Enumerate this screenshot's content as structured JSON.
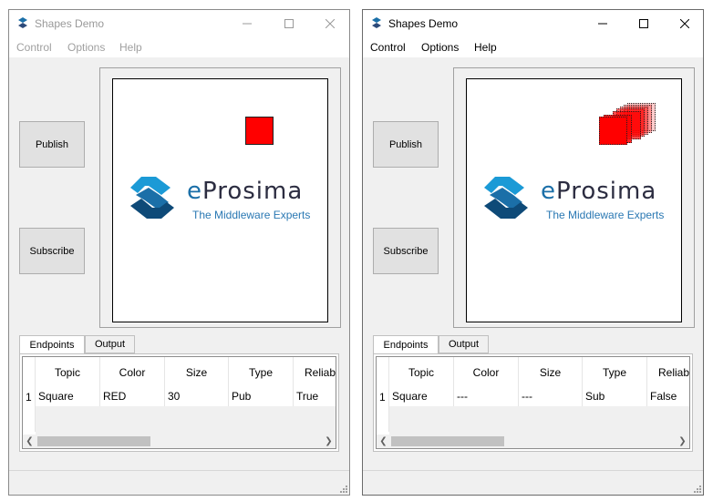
{
  "colors": {
    "accent": "#1b6fa8",
    "square_red": "#ff0000"
  },
  "windows": [
    {
      "title": "Shapes Demo",
      "menu": [
        "Control",
        "Options",
        "Help"
      ],
      "buttons": {
        "publish": "Publish",
        "subscribe": "Subscribe"
      },
      "logo": {
        "brand_e": "e",
        "brand_rest": "Prosima",
        "tagline": "The Middleware Experts"
      },
      "tabs": [
        "Endpoints",
        "Output"
      ],
      "table": {
        "columns": [
          "Topic",
          "Color",
          "Size",
          "Type",
          "Reliabl"
        ],
        "rows": [
          {
            "index": "1",
            "topic": "Square",
            "color": "RED",
            "size": "30",
            "type": "Pub",
            "reliable": "True"
          }
        ]
      }
    },
    {
      "title": "Shapes Demo",
      "menu": [
        "Control",
        "Options",
        "Help"
      ],
      "buttons": {
        "publish": "Publish",
        "subscribe": "Subscribe"
      },
      "logo": {
        "brand_e": "e",
        "brand_rest": "Prosima",
        "tagline": "The Middleware Experts"
      },
      "tabs": [
        "Endpoints",
        "Output"
      ],
      "table": {
        "columns": [
          "Topic",
          "Color",
          "Size",
          "Type",
          "Reliabl"
        ],
        "rows": [
          {
            "index": "1",
            "topic": "Square",
            "color": "---",
            "size": "---",
            "type": "Sub",
            "reliable": "False"
          }
        ]
      }
    }
  ]
}
